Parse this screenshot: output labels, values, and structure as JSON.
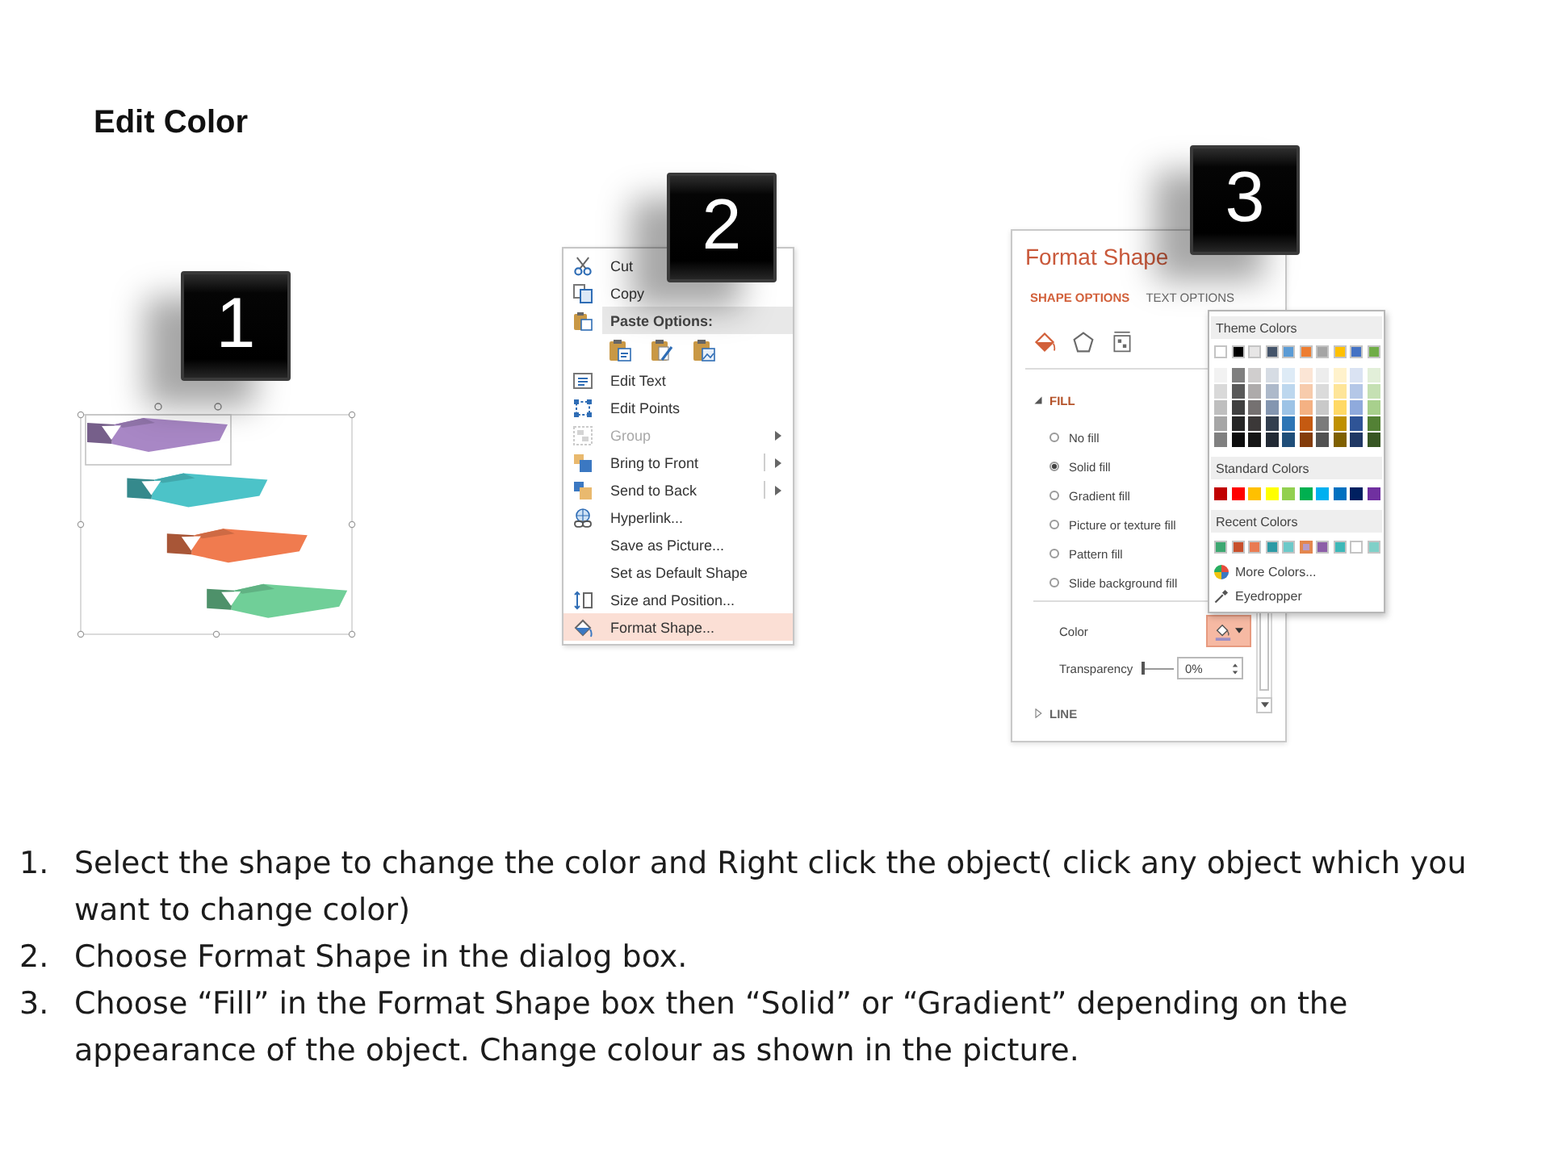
{
  "title": "Edit Color",
  "step_badges": [
    {
      "label": "1"
    },
    {
      "label": "2"
    },
    {
      "label": "3"
    }
  ],
  "shapes_preview": {
    "shapes": [
      {
        "color": "#a887c5"
      },
      {
        "color": "#4cc3c8"
      },
      {
        "color": "#f07b4f"
      },
      {
        "color": "#70cf98"
      }
    ]
  },
  "context_menu": {
    "items": [
      {
        "kind": "command",
        "label": "Cut",
        "disabled": false,
        "submenu": false,
        "split": false,
        "selected": false
      },
      {
        "kind": "command",
        "label": "Copy",
        "disabled": false,
        "submenu": false,
        "split": false,
        "selected": false
      },
      {
        "kind": "header",
        "label": "Paste Options:"
      },
      {
        "kind": "paste_icons"
      },
      {
        "kind": "command",
        "label": "Edit Text",
        "disabled": false,
        "submenu": false,
        "split": false,
        "selected": false
      },
      {
        "kind": "command",
        "label": "Edit Points",
        "disabled": false,
        "submenu": false,
        "split": false,
        "selected": false
      },
      {
        "kind": "command",
        "label": "Group",
        "disabled": true,
        "submenu": true,
        "split": false,
        "selected": false
      },
      {
        "kind": "command",
        "label": "Bring to Front",
        "disabled": false,
        "submenu": true,
        "split": true,
        "selected": false
      },
      {
        "kind": "command",
        "label": "Send to Back",
        "disabled": false,
        "submenu": true,
        "split": true,
        "selected": false
      },
      {
        "kind": "command",
        "label": "Hyperlink...",
        "disabled": false,
        "submenu": false,
        "split": false,
        "selected": false
      },
      {
        "kind": "command",
        "label": "Save as Picture...",
        "disabled": false,
        "submenu": false,
        "split": false,
        "selected": false
      },
      {
        "kind": "command",
        "label": "Set as Default Shape",
        "disabled": false,
        "submenu": false,
        "split": false,
        "selected": false
      },
      {
        "kind": "command",
        "label": "Size and Position...",
        "disabled": false,
        "submenu": false,
        "split": false,
        "selected": false
      },
      {
        "kind": "command",
        "label": "Format Shape...",
        "disabled": false,
        "submenu": false,
        "split": false,
        "selected": true
      }
    ]
  },
  "format_panel": {
    "title": "Format Shape",
    "tabs": [
      {
        "label": "SHAPE OPTIONS",
        "selected": true
      },
      {
        "label": "TEXT OPTIONS",
        "selected": false
      }
    ],
    "icon_tabs": [
      {
        "selected": true
      },
      {
        "selected": false
      },
      {
        "selected": false
      }
    ],
    "fill": {
      "label": "FILL",
      "expanded": true,
      "options": [
        {
          "label": "No fill",
          "selected": false
        },
        {
          "label": "Solid fill",
          "selected": true
        },
        {
          "label": "Gradient fill",
          "selected": false
        },
        {
          "label": "Picture or texture fill",
          "selected": false
        },
        {
          "label": "Pattern fill",
          "selected": false
        },
        {
          "label": "Slide background fill",
          "selected": false
        }
      ],
      "color_label": "Color",
      "color_button_open": true,
      "transparency_label": "Transparency",
      "transparency": {
        "level": 0,
        "value": "0%"
      }
    },
    "line": {
      "label": "LINE",
      "expanded": false
    }
  },
  "color_menu": {
    "theme_title": "Theme Colors",
    "theme_colors": [
      {
        "color": "#ffffff",
        "shades": [
          {
            "color": "#f2f2f2"
          },
          {
            "color": "#d9d9d9"
          },
          {
            "color": "#bfbfbf"
          },
          {
            "color": "#a6a6a6"
          },
          {
            "color": "#808080"
          }
        ]
      },
      {
        "color": "#000000",
        "shades": [
          {
            "color": "#7f7f7f"
          },
          {
            "color": "#595959"
          },
          {
            "color": "#404040"
          },
          {
            "color": "#262626"
          },
          {
            "color": "#0d0d0d"
          }
        ]
      },
      {
        "color": "#e7e6e6",
        "shades": [
          {
            "color": "#d0cece"
          },
          {
            "color": "#aeabab"
          },
          {
            "color": "#757171"
          },
          {
            "color": "#3b3838"
          },
          {
            "color": "#161616"
          }
        ]
      },
      {
        "color": "#44546a",
        "shades": [
          {
            "color": "#d6dce4"
          },
          {
            "color": "#adb9ca"
          },
          {
            "color": "#8496b0"
          },
          {
            "color": "#333f4f"
          },
          {
            "color": "#222a35"
          }
        ]
      },
      {
        "color": "#5b9bd5",
        "shades": [
          {
            "color": "#deebf6"
          },
          {
            "color": "#bdd7ee"
          },
          {
            "color": "#9dc3e6"
          },
          {
            "color": "#2e75b5"
          },
          {
            "color": "#1f4e79"
          }
        ]
      },
      {
        "color": "#ed7d31",
        "shades": [
          {
            "color": "#fbe5d5"
          },
          {
            "color": "#f7cbac"
          },
          {
            "color": "#f4b183"
          },
          {
            "color": "#c55a11"
          },
          {
            "color": "#843c0b"
          }
        ]
      },
      {
        "color": "#a5a5a5",
        "shades": [
          {
            "color": "#ededed"
          },
          {
            "color": "#dbdbdb"
          },
          {
            "color": "#c9c9c9"
          },
          {
            "color": "#7b7b7b"
          },
          {
            "color": "#525252"
          }
        ]
      },
      {
        "color": "#ffc000",
        "shades": [
          {
            "color": "#fff2cc"
          },
          {
            "color": "#fee599"
          },
          {
            "color": "#ffd965"
          },
          {
            "color": "#bf9000"
          },
          {
            "color": "#7f6000"
          }
        ]
      },
      {
        "color": "#4472c4",
        "shades": [
          {
            "color": "#dae3f3"
          },
          {
            "color": "#b4c7e7"
          },
          {
            "color": "#8faadc"
          },
          {
            "color": "#2f5496"
          },
          {
            "color": "#203864"
          }
        ]
      },
      {
        "color": "#70ad47",
        "shades": [
          {
            "color": "#e2efd9"
          },
          {
            "color": "#c5e0b3"
          },
          {
            "color": "#a8d08d"
          },
          {
            "color": "#538135"
          },
          {
            "color": "#375623"
          }
        ]
      }
    ],
    "standard_title": "Standard Colors",
    "standard_colors": [
      {
        "color": "#c00000"
      },
      {
        "color": "#ff0000"
      },
      {
        "color": "#ffc000"
      },
      {
        "color": "#ffff00"
      },
      {
        "color": "#92d050"
      },
      {
        "color": "#00b050"
      },
      {
        "color": "#00b0f0"
      },
      {
        "color": "#0070c0"
      },
      {
        "color": "#002060"
      },
      {
        "color": "#7030a0"
      }
    ],
    "recent_title": "Recent Colors",
    "recent_colors": [
      {
        "color": "#3ea872",
        "selected": false
      },
      {
        "color": "#c8502c",
        "selected": false
      },
      {
        "color": "#e97b52",
        "selected": false
      },
      {
        "color": "#2c9aa5",
        "selected": false
      },
      {
        "color": "#6cc9c9",
        "selected": false
      },
      {
        "color": "#b79cc8",
        "selected": true
      },
      {
        "color": "#8c5ea8",
        "selected": false
      },
      {
        "color": "#3db8b8",
        "selected": false
      },
      {
        "color": "#ffffff",
        "selected": false
      },
      {
        "color": "#7fd0c8",
        "selected": false
      }
    ],
    "actions": [
      {
        "label": "More Colors..."
      },
      {
        "label": "Eyedropper"
      }
    ]
  },
  "instructions": [
    {
      "number": "1.",
      "text": "Select the shape to change the color and Right click the object( click any object which you want to change color)"
    },
    {
      "number": "2.",
      "text": "Choose Format Shape in the dialog box."
    },
    {
      "number": "3.",
      "text": "Choose “Fill” in the Format Shape box then “Solid” or “Gradient” depending on the appearance of the object. Change colour as shown in the picture."
    }
  ]
}
